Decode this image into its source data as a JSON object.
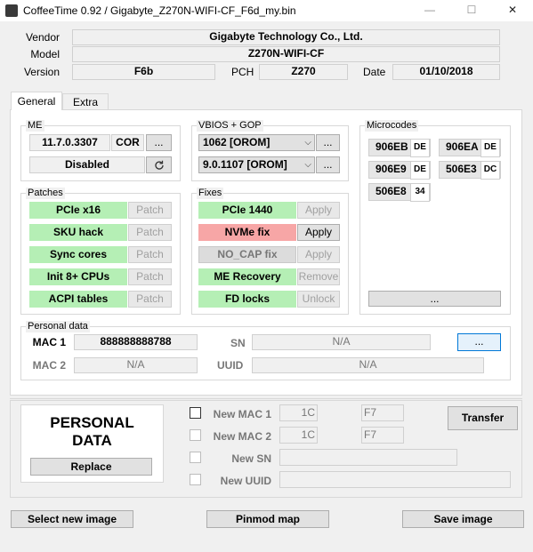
{
  "window": {
    "title": "CoffeeTime 0.92  /  Gigabyte_Z270N-WIFI-CF_F6d_my.bin",
    "minimize": "—",
    "maximize": "☐",
    "close": "✕"
  },
  "info": {
    "vendor_label": "Vendor",
    "vendor": "Gigabyte Technology Co., Ltd.",
    "model_label": "Model",
    "model": "Z270N-WIFI-CF",
    "version_label": "Version",
    "version": "F6b",
    "pch_label": "PCH",
    "pch": "Z270",
    "date_label": "Date",
    "date": "01/10/2018"
  },
  "tabs": [
    {
      "label": "General"
    },
    {
      "label": "Extra"
    }
  ],
  "me": {
    "title": "ME",
    "version": "11.7.0.3307",
    "type": "COR",
    "browse": "...",
    "state": "Disabled",
    "refresh_icon": "refresh-icon"
  },
  "vbios": {
    "title": "VBIOS + GOP",
    "vbios": "1062 [OROM]",
    "gop": "9.0.1107 [OROM]",
    "browse": "..."
  },
  "microcodes": {
    "title": "Microcodes",
    "items": [
      {
        "id": "906EB",
        "tag": "DE"
      },
      {
        "id": "906EA",
        "tag": "DE"
      },
      {
        "id": "906E9",
        "tag": "DE"
      },
      {
        "id": "506E3",
        "tag": "DC"
      },
      {
        "id": "506E8",
        "tag": "34"
      }
    ],
    "browse": "..."
  },
  "patches": {
    "title": "Patches",
    "items": [
      {
        "label": "PCIe x16",
        "action": "Patch"
      },
      {
        "label": "SKU hack",
        "action": "Patch"
      },
      {
        "label": "Sync cores",
        "action": "Patch"
      },
      {
        "label": "Init 8+ CPUs",
        "action": "Patch"
      },
      {
        "label": "ACPI tables",
        "action": "Patch"
      }
    ]
  },
  "fixes": {
    "title": "Fixes",
    "items": [
      {
        "label": "PCIe 1440",
        "action": "Apply"
      },
      {
        "label": "NVMe fix",
        "action": "Apply"
      },
      {
        "label": "NO_CAP fix",
        "action": "Apply"
      },
      {
        "label": "ME Recovery",
        "action": "Remove"
      },
      {
        "label": "FD locks",
        "action": "Unlock"
      }
    ]
  },
  "personal": {
    "title": "Personal data",
    "mac1_label": "MAC 1",
    "mac1": "888888888788",
    "mac2_label": "MAC 2",
    "mac2": "N/A",
    "sn_label": "SN",
    "sn": "N/A",
    "uuid_label": "UUID",
    "uuid": "N/A",
    "browse": "..."
  },
  "transfer": {
    "heading_line1": "PERSONAL",
    "heading_line2": "DATA",
    "replace": "Replace",
    "new_mac1_label": "New  MAC 1",
    "new_mac1_prefix": "1C",
    "new_mac1_suffix": "F7",
    "new_mac2_label": "New  MAC 2",
    "new_mac2_prefix": "1C",
    "new_mac2_suffix": "F7",
    "new_sn_label": "New  SN",
    "new_uuid_label": "New  UUID",
    "transfer_button": "Transfer"
  },
  "bottom": {
    "select_image": "Select new image",
    "pinmod_map": "Pinmod map",
    "save_image": "Save image"
  },
  "colors": {
    "accent_green": "#b5efb5",
    "accent_red": "#f7a6a6",
    "focus_blue": "#0078d7"
  }
}
